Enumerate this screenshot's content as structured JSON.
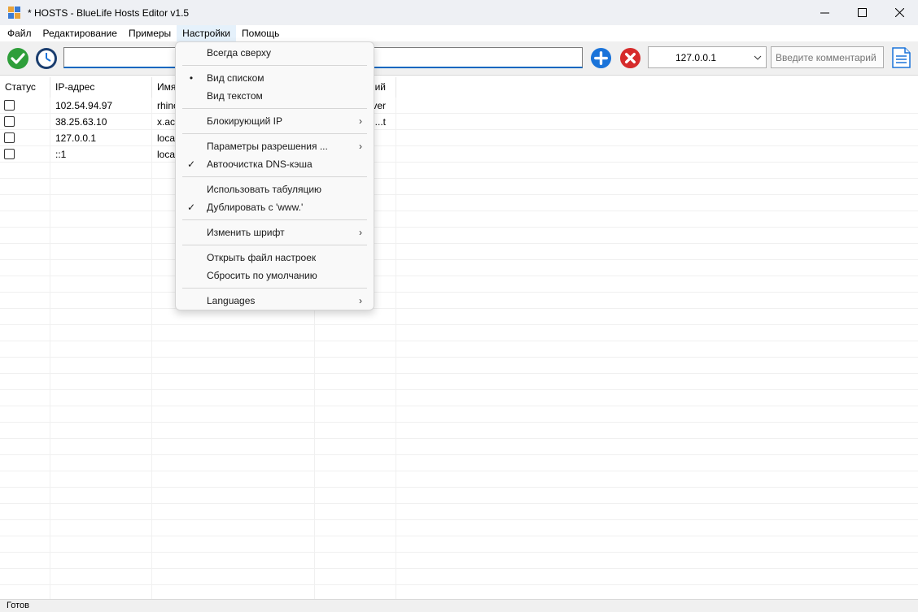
{
  "window": {
    "title": "* HOSTS - BlueLife Hosts Editor v1.5",
    "controls": [
      "minimize-icon",
      "maximize-icon",
      "close-icon"
    ]
  },
  "menubar": {
    "items": [
      "Файл",
      "Редактирование",
      "Примеры",
      "Настройки",
      "Помощь"
    ],
    "active": "Настройки"
  },
  "toolbar": {
    "icons": [
      "apply-check-icon",
      "backup-clock-icon",
      "add-plus-icon",
      "delete-x-icon",
      "notepad-icon"
    ],
    "ip_input_value": "",
    "ip_combo_value": "127.0.0.1",
    "comment_placeholder": "Введите комментарий"
  },
  "list": {
    "columns": [
      "Статус",
      "IP-адрес",
      "Имя",
      "...ий",
      ""
    ],
    "rows": [
      {
        "checked": false,
        "ip": "102.54.94.97",
        "name": "rhino",
        "comment": "...ver"
      },
      {
        "checked": false,
        "ip": "38.25.63.10",
        "name": "x.ac",
        "comment": "...t"
      },
      {
        "checked": false,
        "ip": "127.0.0.1",
        "name": "loca",
        "comment": ""
      },
      {
        "checked": false,
        "ip": "::1",
        "name": "loca",
        "comment": ""
      }
    ]
  },
  "settings_menu": {
    "groups": [
      [
        {
          "label": "Всегда сверху",
          "mark": "",
          "submenu": false
        }
      ],
      [
        {
          "label": "Вид списком",
          "mark": "•",
          "submenu": false
        },
        {
          "label": "Вид текстом",
          "mark": "",
          "submenu": false
        }
      ],
      [
        {
          "label": "Блокирующий IP",
          "mark": "",
          "submenu": true
        }
      ],
      [
        {
          "label": "Параметры разрешения ...",
          "mark": "",
          "submenu": true
        },
        {
          "label": "Автоочистка DNS-кэша",
          "mark": "✓",
          "submenu": false
        }
      ],
      [
        {
          "label": "Использовать табуляцию",
          "mark": "",
          "submenu": false
        },
        {
          "label": "Дублировать с 'www.'",
          "mark": "✓",
          "submenu": false
        }
      ],
      [
        {
          "label": "Изменить шрифт",
          "mark": "",
          "submenu": true
        }
      ],
      [
        {
          "label": "Открыть файл настроек",
          "mark": "",
          "submenu": false
        },
        {
          "label": "Сбросить по умолчанию",
          "mark": "",
          "submenu": false
        }
      ],
      [
        {
          "label": "Languages",
          "mark": "",
          "submenu": true
        }
      ]
    ]
  },
  "status": {
    "text": "Готов"
  },
  "colors": {
    "accent": "#0067c0",
    "check_green": "#2e9e3a",
    "add_blue": "#1a73d9",
    "delete_red": "#d62b2b"
  }
}
